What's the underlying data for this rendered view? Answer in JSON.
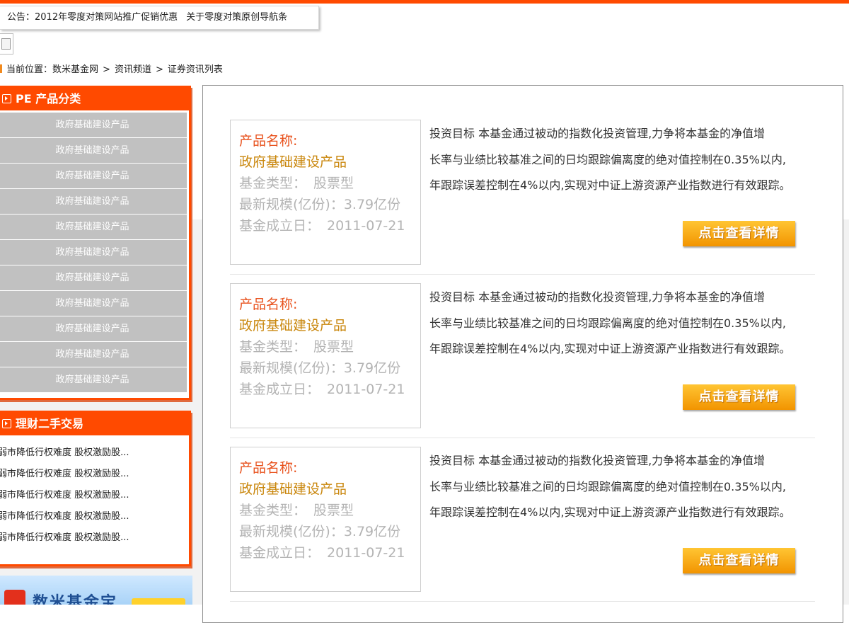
{
  "notice": {
    "label": "公告：",
    "items": [
      "2012年零度对策网站推广促销优惠",
      "关于零度对策原创导航条"
    ]
  },
  "breadcrumb": {
    "prefix": "当前位置：",
    "items": [
      "数米基金网",
      "资讯频道",
      "证券资讯列表"
    ],
    "separator": ">"
  },
  "products_panel": {
    "title": "PE 产品分类",
    "items": [
      "政府基础建设产品",
      "政府基础建设产品",
      "政府基础建设产品",
      "政府基础建设产品",
      "政府基础建设产品",
      "政府基础建设产品",
      "政府基础建设产品",
      "政府基础建设产品",
      "政府基础建设产品",
      "政府基础建设产品",
      "政府基础建设产品"
    ]
  },
  "trade_panel": {
    "title": "理财二手交易",
    "items": [
      "弱市降低行权难度 股权激励股...",
      "弱市降低行权难度 股权激励股...",
      "弱市降低行权难度 股权激励股...",
      "弱市降低行权难度 股权激励股...",
      "弱市降低行权难度 股权激励股..."
    ]
  },
  "banner": {
    "text": "数米基金宝"
  },
  "products": [
    {
      "name_label": "产品名称:",
      "name": "政府基础建设产品",
      "type_label": "基金类型：",
      "type": "股票型",
      "scale_label": "最新规模(亿份)：",
      "scale": "3.79亿份",
      "date_label": "基金成立日：",
      "date": "2011-07-21",
      "desc": [
        "投资目标 本基金通过被动的指数化投资管理,力争将本基金的净值增",
        "长率与业绩比较基准之间的日均跟踪偏离度的绝对值控制在0.35%以内,",
        "年跟踪误差控制在4%以内,实现对中证上游资源产业指数进行有效跟踪。"
      ],
      "button": "点击查看详情"
    },
    {
      "name_label": "产品名称:",
      "name": "政府基础建设产品",
      "type_label": "基金类型：",
      "type": "股票型",
      "scale_label": "最新规模(亿份)：",
      "scale": "3.79亿份",
      "date_label": "基金成立日：",
      "date": "2011-07-21",
      "desc": [
        "投资目标 本基金通过被动的指数化投资管理,力争将本基金的净值增",
        "长率与业绩比较基准之间的日均跟踪偏离度的绝对值控制在0.35%以内,",
        "年跟踪误差控制在4%以内,实现对中证上游资源产业指数进行有效跟踪。"
      ],
      "button": "点击查看详情"
    },
    {
      "name_label": "产品名称:",
      "name": "政府基础建设产品",
      "type_label": "基金类型：",
      "type": "股票型",
      "scale_label": "最新规模(亿份)：",
      "scale": "3.79亿份",
      "date_label": "基金成立日：",
      "date": "2011-07-21",
      "desc": [
        "投资目标 本基金通过被动的指数化投资管理,力争将本基金的净值增",
        "长率与业绩比较基准之间的日均跟踪偏离度的绝对值控制在0.35%以内,",
        "年跟踪误差控制在4%以内,实现对中证上游资源产业指数进行有效跟踪。"
      ],
      "button": "点击查看详情"
    }
  ],
  "colors": {
    "accent": "#ff4a00",
    "product_name": "#e8511c",
    "product_title": "#c9860b",
    "muted": "#b4b4b4",
    "button": "#f29400"
  }
}
